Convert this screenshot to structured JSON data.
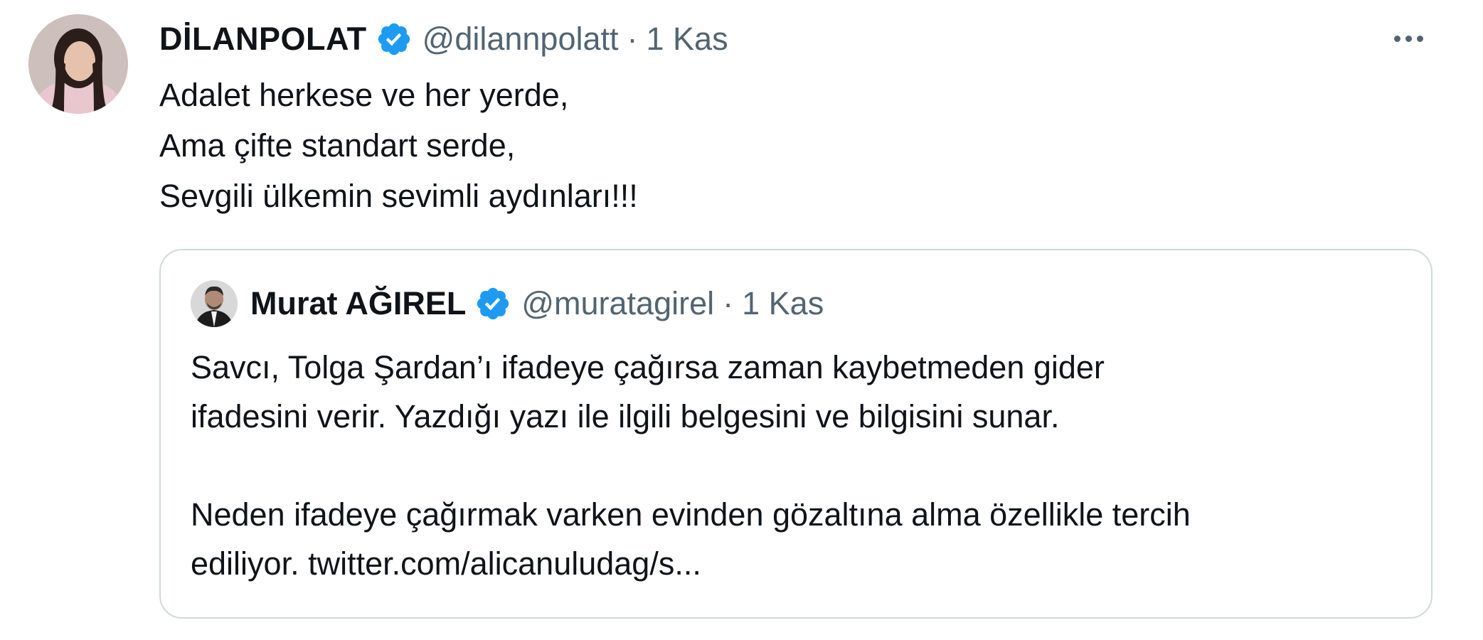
{
  "tweet": {
    "author": {
      "display_name": "DİLANPOLAT",
      "handle": "@dilannpolatt",
      "verified_icon": "verified-badge-icon"
    },
    "separator": "·",
    "timestamp": "1 Kas",
    "more_icon": "more-options-icon",
    "text_lines": [
      "Adalet herkese ve her yerde,",
      "Ama çifte standart serde,",
      "Sevgili ülkemin sevimli aydınları!!!"
    ]
  },
  "quoted_tweet": {
    "author": {
      "display_name": "Murat AĞIREL",
      "handle": "@muratagirel",
      "verified_icon": "verified-badge-icon"
    },
    "separator": "·",
    "timestamp": "1 Kas",
    "paragraph1": [
      "Savcı, Tolga Şardan’ı ifadeye çağırsa zaman kaybetmeden gider",
      "ifadesini verir. Yazdığı yazı ile ilgili belgesini ve bilgisini sunar."
    ],
    "paragraph2": [
      "Neden ifadeye çağırmak varken evinden gözaltına alma özellikle tercih",
      "ediliyor. twitter.com/alicanuludag/s..."
    ]
  },
  "colors": {
    "text_primary": "#0f1419",
    "text_secondary": "#536471",
    "verified_blue": "#1d9bf0",
    "border": "#cfd9de"
  }
}
